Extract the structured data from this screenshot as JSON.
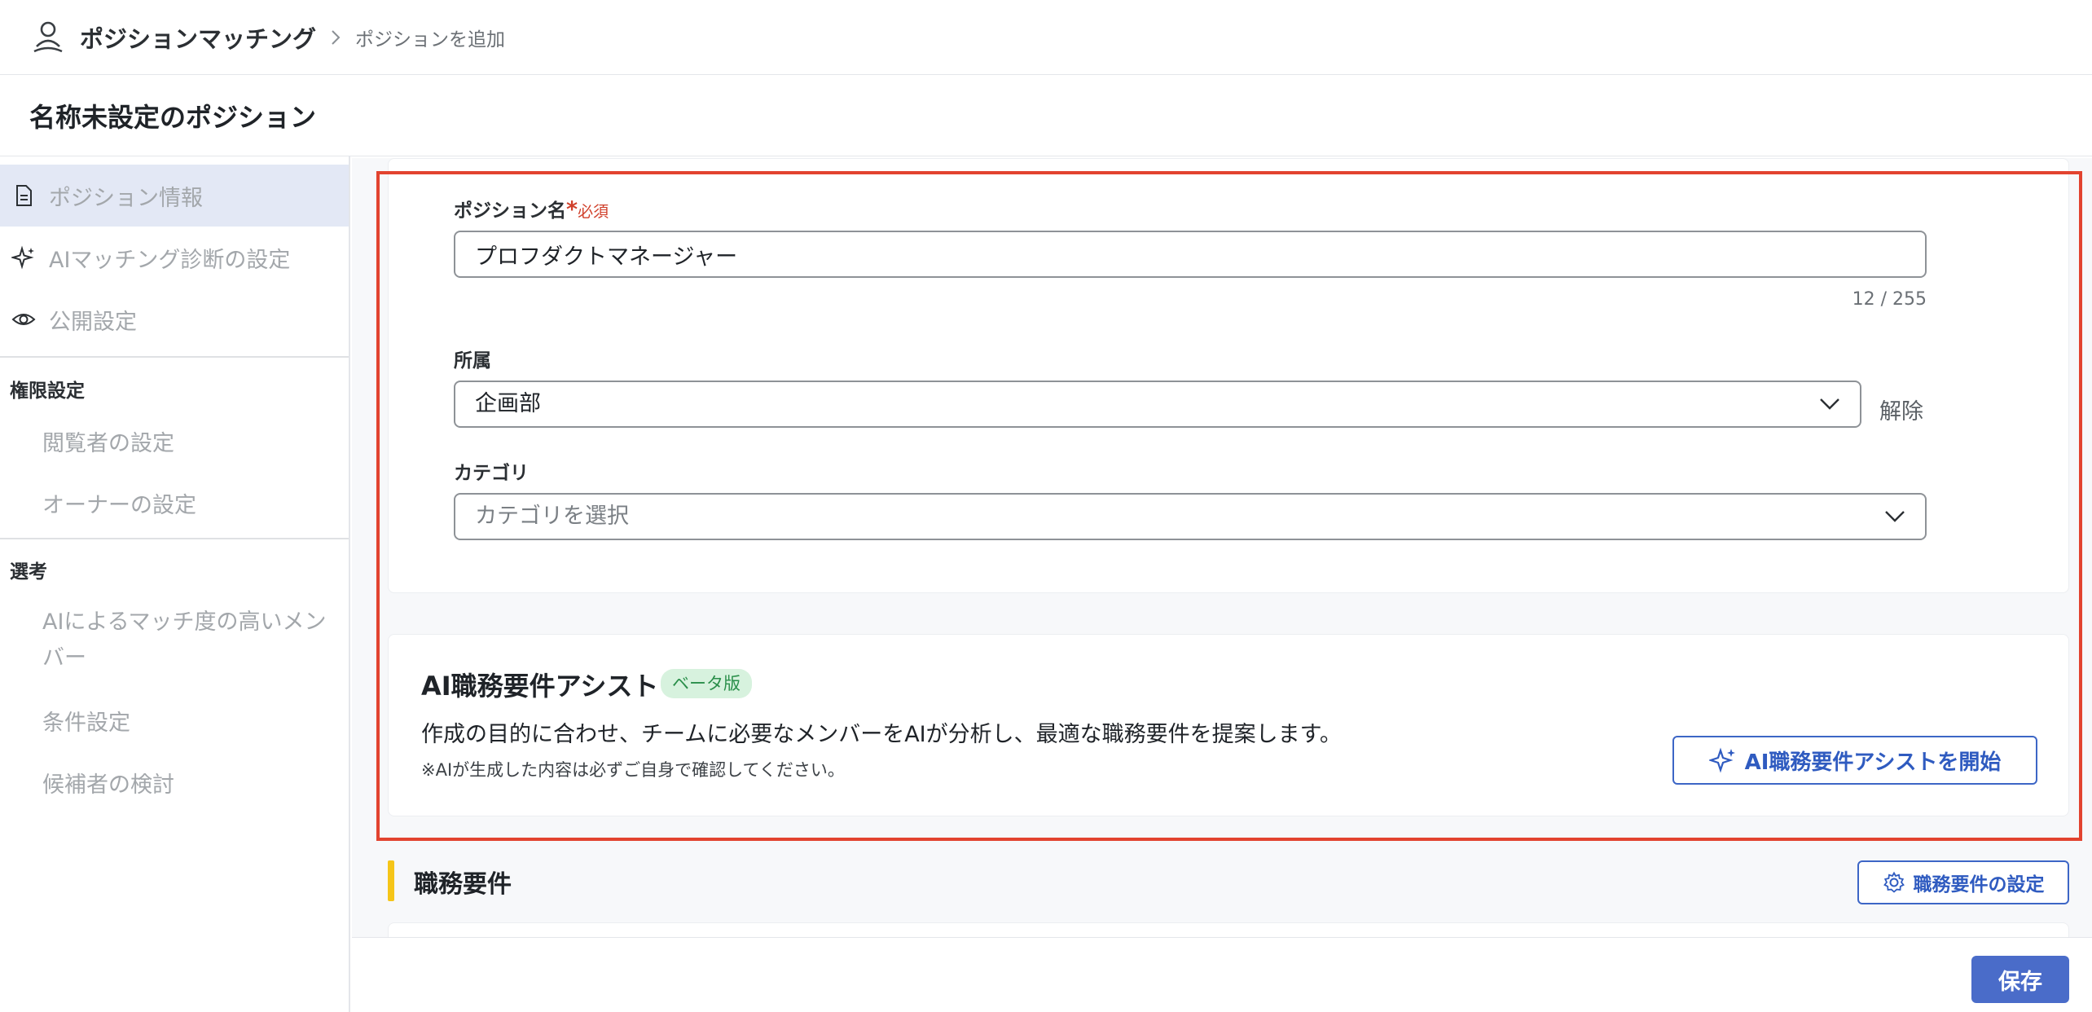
{
  "app": {
    "name": "ポジションマッチング",
    "breadcrumb_current": "ポジションを追加"
  },
  "page": {
    "title": "名称未設定のポジション"
  },
  "sidebar": {
    "items": [
      {
        "label": "ポジション情報",
        "icon": "document-icon"
      },
      {
        "label": "AIマッチング診断の設定",
        "icon": "sparkle-icon"
      },
      {
        "label": "公開設定",
        "icon": "eye-icon"
      }
    ],
    "sections": [
      {
        "title": "権限設定",
        "items": [
          "閲覧者の設定",
          "オーナーの設定"
        ]
      },
      {
        "title": "選考",
        "items": [
          "AIによるマッチ度の高いメンバー",
          "条件設定",
          "候補者の検討"
        ]
      }
    ]
  },
  "form": {
    "position_name": {
      "label": "ポジション名",
      "required_mark": "*",
      "required_text": "必須",
      "value": "プロフダクトマネージャー",
      "counter": "12 / 255"
    },
    "department": {
      "label": "所属",
      "value": "企画部",
      "clear_label": "解除"
    },
    "category": {
      "label": "カテゴリ",
      "placeholder": "カテゴリを選択"
    }
  },
  "ai_assist": {
    "title": "AI職務要件アシスト",
    "badge": "ベータ版",
    "description": "作成の目的に合わせ、チームに必要なメンバーをAIが分析し、最適な職務要件を提案します。",
    "note": "※AIが生成した内容は必ずご自身で確認してください。",
    "button_label": "AI職務要件アシストを開始"
  },
  "job_requirements": {
    "title": "職務要件",
    "settings_button": "職務要件の設定"
  },
  "footer": {
    "save_label": "保存"
  },
  "colors": {
    "accent": "#3d66c6",
    "highlight": "#e2432f",
    "section_bar": "#f5c518",
    "required": "#d0402b"
  }
}
